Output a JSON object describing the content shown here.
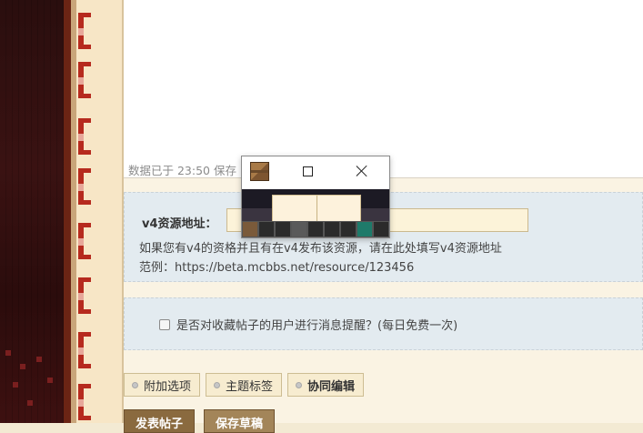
{
  "editor": {
    "status_text": "数据已于 23:50 保存"
  },
  "v4_resource": {
    "label": "v4资源地址：",
    "input_value": "",
    "help_line1": "如果您有v4的资格并且有在v4发布该资源，请在此处填写v4资源地址",
    "help_line2": "范例：https://beta.mcbbs.net/resource/123456"
  },
  "remind": {
    "label": "是否对收藏帖子的用户进行消息提醒？(每日免费一次)",
    "checked": false
  },
  "tabs": [
    {
      "label": "附加选项"
    },
    {
      "label": "主题标签"
    },
    {
      "label": "协同编辑"
    }
  ],
  "buttons": {
    "publish": "发表帖子",
    "save_draft": "保存草稿"
  },
  "mini_window": {
    "icon": "crafting-table-icon"
  },
  "colors": {
    "panel_bg": "#e3ebf0",
    "input_bg": "#fcf3d9",
    "button_bg": "#8a6a3f",
    "border_red": "#b62a1e"
  }
}
